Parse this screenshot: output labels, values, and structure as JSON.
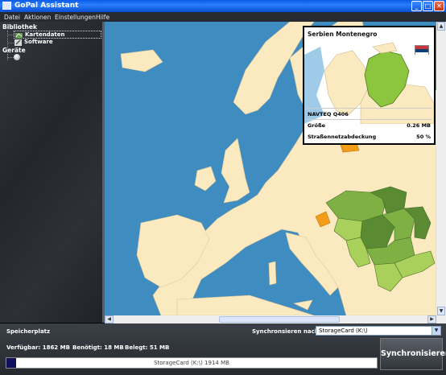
{
  "window": {
    "title": "GoPal Assistant"
  },
  "menu": [
    "Datei",
    "Aktionen",
    "Einstellungen",
    "Hilfe"
  ],
  "sidebar": {
    "library_heading": "Bibliothek",
    "items": [
      {
        "label": "Kartendaten",
        "icon": "map-data-icon",
        "selected": true
      },
      {
        "label": "Software",
        "icon": "software-icon",
        "selected": false
      }
    ],
    "devices_heading": "Geräte"
  },
  "popup": {
    "country": "Serbien Montenegro",
    "provider": "NAVTEQ Q406",
    "size_label": "Größe",
    "size_value": "0.26 MB",
    "coverage_label": "Straßennetzabdeckung",
    "coverage_value": "50 %"
  },
  "bottom": {
    "storage_heading": "Speicherplatz",
    "sync_to_label": "Synchronsieren nach:",
    "sync_target": "StorageCard (K:\\)",
    "available": "Verfügbar: 1862 MB",
    "needed": "Benötigt: 18 MB",
    "used": "Belegt: 51 MB",
    "bar_text": "StorageCard (K:\\) 1914 MB",
    "bar_used_fraction": 0.027,
    "sync_button": "Synchronisieren"
  },
  "colors": {
    "sea": "#3e8cc0",
    "land": "#fbe9c0",
    "coverage_dark": "#5a8a32",
    "coverage_mid": "#7fb044",
    "coverage_light": "#a8d05a",
    "highlight": "#f39c18"
  }
}
